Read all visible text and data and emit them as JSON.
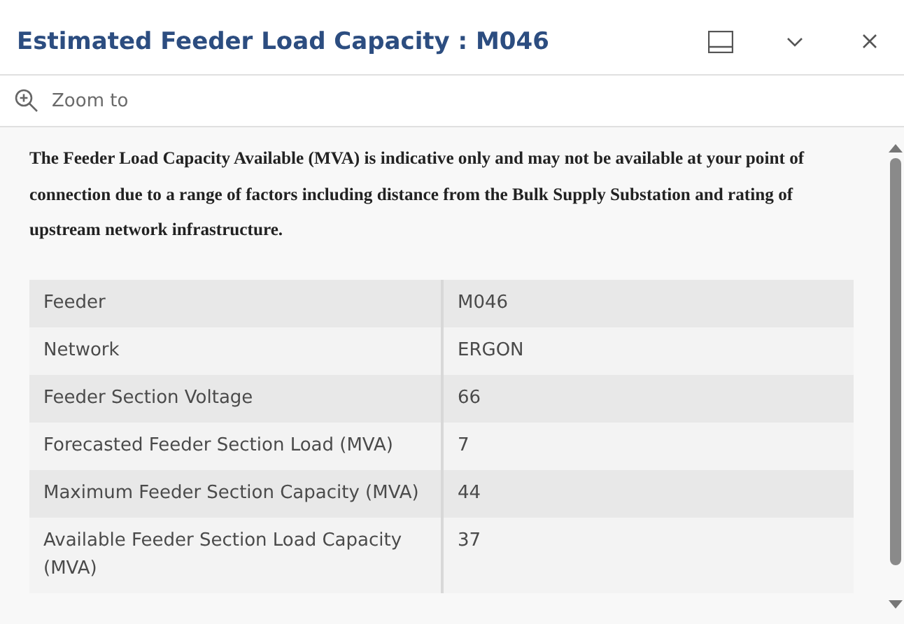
{
  "window": {
    "title": "Estimated Feeder Load Capacity : M046"
  },
  "toolbar": {
    "action": "Zoom to"
  },
  "notice": "The Feeder Load Capacity Available (MVA) is indicative only and may not be available at your point of connection due to a range of factors including distance from the Bulk Supply Substation and rating of upstream network infrastructure.",
  "table": {
    "rows": [
      {
        "field": "Feeder",
        "value": "M046"
      },
      {
        "field": "Network",
        "value": "ERGON"
      },
      {
        "field": "Feeder Section Voltage",
        "value": "66"
      },
      {
        "field": "Forecasted Feeder Section Load (MVA)",
        "value": "7"
      },
      {
        "field": "Maximum Feeder Section Capacity (MVA)",
        "value": "44"
      },
      {
        "field": "Available Feeder Section Load Capacity (MVA)",
        "value": "37"
      }
    ]
  }
}
